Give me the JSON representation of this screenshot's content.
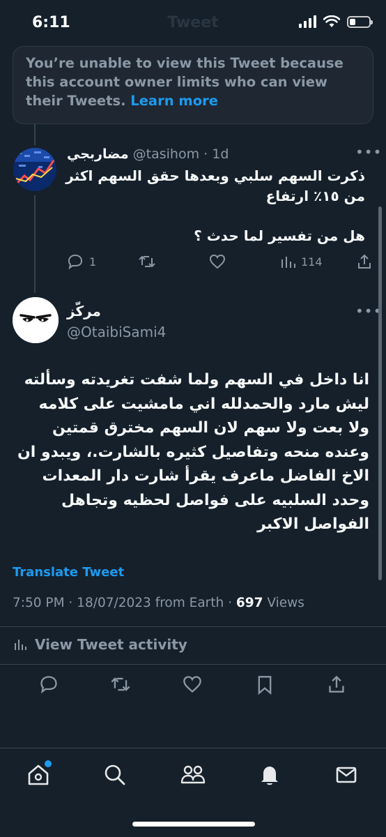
{
  "status_bar": {
    "time": "6:11",
    "faded_title": "Tweet"
  },
  "notice": {
    "text": "You’re unable to view this Tweet because this account owner limits who can view their Tweets. ",
    "link": "Learn more"
  },
  "reply_tweet": {
    "name": "مضاربجي",
    "handle": "@tasihom",
    "time": "· 1d",
    "text_line1": "ذكرت السهم سلبي وبعدها حقق السهم اكثر من ١٥٪ ارتفاع",
    "text_line2": "هل من تفسير لما حدث ؟",
    "replies": "1",
    "views": "114"
  },
  "main_tweet": {
    "name": "مركّز",
    "handle": "@OtaibiSami4",
    "text": "انا داخل في السهم ولما شفت تغريدته وسألته ليش مارد والحمدلله اني مامشيت على كلامه ولا بعت ولا سهم لان السهم مخترق قمتين وعنده منحه وتفاصيل كثيره بالشارت.، ويبدو ان الاخ الفاضل ماعرف يقرأ شارت دار المعدات وحدد السلبيه على فواصل لحظيه وتجاهل الفواصل الاكبر",
    "translate_label": "Translate Tweet",
    "meta_prefix": "7:50 PM · 18/07/2023 from Earth · ",
    "views_count": "697",
    "views_label": " Views",
    "activity_label": "View Tweet activity"
  },
  "colors": {
    "background": "#15202b",
    "accent": "#1d9bf0",
    "muted": "#8b98a5"
  },
  "nav": [
    "home-icon",
    "search-icon",
    "communities-icon",
    "notifications-icon",
    "messages-icon"
  ]
}
